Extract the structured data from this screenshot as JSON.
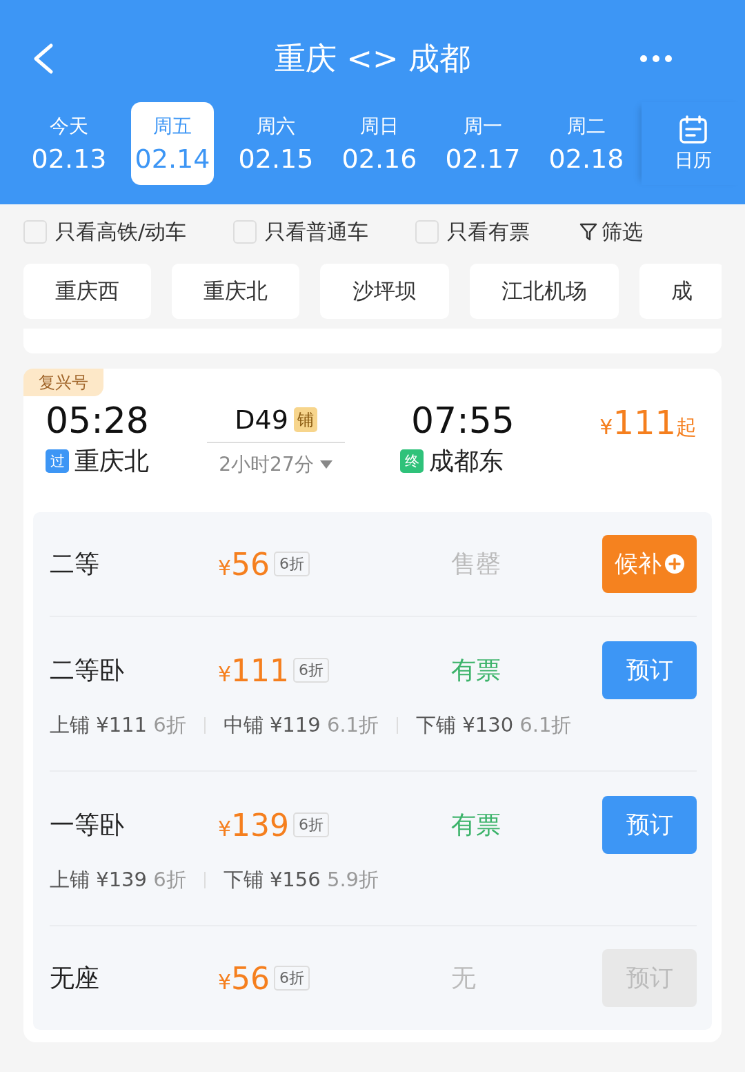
{
  "header": {
    "title": "重庆 <> 成都"
  },
  "dates": [
    {
      "weekday": "今天",
      "date": "02.13",
      "selected": false
    },
    {
      "weekday": "周五",
      "date": "02.14",
      "selected": true
    },
    {
      "weekday": "周六",
      "date": "02.15",
      "selected": false
    },
    {
      "weekday": "周日",
      "date": "02.16",
      "selected": false
    },
    {
      "weekday": "周一",
      "date": "02.17",
      "selected": false
    },
    {
      "weekday": "周二",
      "date": "02.18",
      "selected": false
    }
  ],
  "calendar_button": {
    "label": "日历"
  },
  "filters": [
    {
      "label": "只看高铁/动车",
      "checked": false
    },
    {
      "label": "只看普通车",
      "checked": false
    },
    {
      "label": "只看有票",
      "checked": false
    }
  ],
  "filter_button": {
    "label": "筛选"
  },
  "stations": [
    "重庆西",
    "重庆北",
    "沙坪坝",
    "江北机场",
    "成"
  ],
  "train": {
    "badge": "复兴号",
    "depart_time": "05:28",
    "depart_station": "重庆北",
    "depart_tag": "过",
    "number": "D49",
    "number_tag": "铺",
    "duration": "2小时27分",
    "arrive_time": "07:55",
    "arrive_station": "成都东",
    "arrive_tag": "终",
    "currency": "¥",
    "price": "111",
    "price_suffix": "起",
    "seats": [
      {
        "name": "二等",
        "currency": "¥",
        "price": "56",
        "discount": "6折",
        "kind": "sold_out",
        "availability": "售罄",
        "button": {
          "kind": "waitlist",
          "label": "候补"
        }
      },
      {
        "name": "二等卧",
        "currency": "¥",
        "price": "111",
        "discount": "6折",
        "kind": "available",
        "availability": "有票",
        "button": {
          "kind": "book",
          "label": "预订"
        },
        "berths": [
          {
            "label": "上铺",
            "price": "¥111",
            "discount": "6折"
          },
          {
            "label": "中铺",
            "price": "¥119",
            "discount": "6.1折"
          },
          {
            "label": "下铺",
            "price": "¥130",
            "discount": "6.1折"
          }
        ]
      },
      {
        "name": "一等卧",
        "currency": "¥",
        "price": "139",
        "discount": "6折",
        "kind": "available",
        "availability": "有票",
        "button": {
          "kind": "book",
          "label": "预订"
        },
        "berths": [
          {
            "label": "上铺",
            "price": "¥139",
            "discount": "6折"
          },
          {
            "label": "下铺",
            "price": "¥156",
            "discount": "5.9折"
          }
        ]
      },
      {
        "name": "无座",
        "currency": "¥",
        "price": "56",
        "discount": "6折",
        "kind": "none",
        "availability": "无",
        "button": {
          "kind": "disabled",
          "label": "预订"
        }
      }
    ]
  }
}
